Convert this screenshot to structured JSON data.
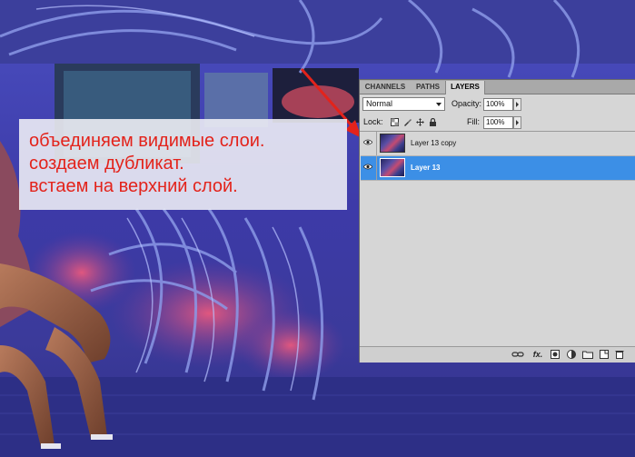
{
  "annotation": {
    "lines": [
      "объединяем видимые слои.",
      "создаем дубликат.",
      "встаем на верхний слой."
    ],
    "text_color": "#e3231b"
  },
  "panel": {
    "tabs": [
      "CHANNELS",
      "PATHS",
      "LAYERS"
    ],
    "active_tab": "LAYERS",
    "blend_mode": "Normal",
    "opacity_label": "Opacity:",
    "opacity_value": "100%",
    "lock_label": "Lock:",
    "fill_label": "Fill:",
    "fill_value": "100%",
    "layers": [
      {
        "name": "Layer 13 copy",
        "visible": true,
        "selected": false
      },
      {
        "name": "Layer 13",
        "visible": true,
        "selected": true
      }
    ],
    "bottom_icons": [
      "link-icon",
      "fx-icon",
      "mask-icon",
      "adjustment-icon",
      "group-icon",
      "new-layer-icon",
      "trash-icon"
    ],
    "fx_label": "fx.",
    "selection_color": "#3c8fe6"
  }
}
